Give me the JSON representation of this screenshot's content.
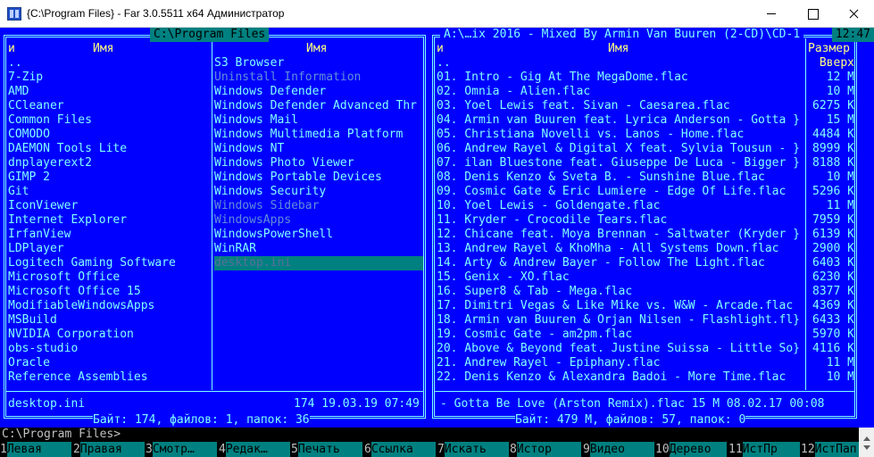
{
  "window": {
    "title": "{C:\\Program Files} - Far 3.0.5511 x64 Администратор"
  },
  "left_panel": {
    "title": "C:\\Program Files",
    "col_n": "и",
    "col_name1": "Имя",
    "col_name2": "Имя",
    "column1": [
      "..",
      "7-Zip",
      "AMD",
      "CCleaner",
      "Common Files",
      "COMODO",
      "DAEMON Tools Lite",
      "dnplayerext2",
      "GIMP 2",
      "Git",
      "IconViewer",
      "Internet Explorer",
      "IrfanView",
      "LDPlayer",
      "Logitech Gaming Software",
      "Microsoft Office",
      "Microsoft Office 15",
      "ModifiableWindowsApps",
      "MSBuild",
      "NVIDIA Corporation",
      "obs-studio",
      "Oracle",
      "Reference Assemblies"
    ],
    "column2": [
      {
        "name": "S3 Browser",
        "state": "normal"
      },
      {
        "name": "Uninstall Information",
        "state": "dim"
      },
      {
        "name": "Windows Defender",
        "state": "normal"
      },
      {
        "name": "Windows Defender Advanced Thr",
        "state": "normal"
      },
      {
        "name": "Windows Mail",
        "state": "normal"
      },
      {
        "name": "Windows Multimedia Platform",
        "state": "normal"
      },
      {
        "name": "Windows NT",
        "state": "normal"
      },
      {
        "name": "Windows Photo Viewer",
        "state": "normal"
      },
      {
        "name": "Windows Portable Devices",
        "state": "normal"
      },
      {
        "name": "Windows Security",
        "state": "normal"
      },
      {
        "name": "Windows Sidebar",
        "state": "dim"
      },
      {
        "name": "WindowsApps",
        "state": "dim"
      },
      {
        "name": "WindowsPowerShell",
        "state": "normal"
      },
      {
        "name": "WinRAR",
        "state": "normal"
      },
      {
        "name": "desktop.ini",
        "state": "selected"
      }
    ],
    "info_name": "desktop.ini",
    "info_meta": "174 19.03.19 07:49",
    "summary": " Байт: 174, файлов: 1, папок: 36 "
  },
  "right_panel": {
    "title": "A:\\…ix 2016 - Mixed By Armin Van Buuren (2-CD)\\CD-1",
    "clock": "12:47",
    "col_n": "и",
    "col_name": "Имя",
    "col_size": "Размер",
    "col_sort": "Вверх",
    "files": [
      {
        "name": "..",
        "size": ""
      },
      {
        "name": "01. Intro - Gig At The MegaDome.flac",
        "size": "12 M"
      },
      {
        "name": "02. Omnia - Alien.flac",
        "size": "10 M"
      },
      {
        "name": "03. Yoel Lewis feat. Sivan - Caesarea.flac",
        "size": "6275 K"
      },
      {
        "name": "04. Armin van Buuren feat. Lyrica Anderson - Gotta }",
        "size": "15 M"
      },
      {
        "name": "05. Christiana Novelli vs. Lanos - Home.flac",
        "size": "4484 K"
      },
      {
        "name": "06. Andrew Rayel & Digital X feat. Sylvia Tousun - }",
        "size": "8999 K"
      },
      {
        "name": "07. ilan Bluestone feat. Giuseppe De Luca - Bigger }",
        "size": "8188 K"
      },
      {
        "name": "08. Denis Kenzo & Sveta B. - Sunshine Blue.flac",
        "size": "10 M"
      },
      {
        "name": "09. Cosmic Gate & Eric Lumiere - Edge Of Life.flac",
        "size": "5296 K"
      },
      {
        "name": "10. Yoel Lewis - Goldengate.flac",
        "size": "11 M"
      },
      {
        "name": "11. Kryder - Crocodile Tears.flac",
        "size": "7959 K"
      },
      {
        "name": "12. Chicane feat. Moya Brennan - Saltwater (Kryder }",
        "size": "6139 K"
      },
      {
        "name": "13. Andrew Rayel & KhoMha - All Systems Down.flac",
        "size": "2900 K"
      },
      {
        "name": "14. Arty & Andrew Bayer - Follow The Light.flac",
        "size": "6403 K"
      },
      {
        "name": "15. Genix - XO.flac",
        "size": "6230 K"
      },
      {
        "name": "16. Super8 & Tab - Mega.flac",
        "size": "8377 K"
      },
      {
        "name": "17. Dimitri Vegas & Like Mike vs. W&W - Arcade.flac",
        "size": "4369 K"
      },
      {
        "name": "18. Armin van Buuren & Orjan Nilsen - Flashlight.fl}",
        "size": "6433 K"
      },
      {
        "name": "19. Cosmic Gate - am2pm.flac",
        "size": "5970 K"
      },
      {
        "name": "20. Above & Beyond feat. Justine Suissa - Little So}",
        "size": "4116 K"
      },
      {
        "name": "21. Andrew Rayel - Epiphany.flac",
        "size": "11 M"
      },
      {
        "name": "22. Denis Kenzo & Alexandra Badoi - More Time.flac",
        "size": "10 M"
      }
    ],
    "info": " - Gotta Be Love (Arston Remix).flac   15 M 08.02.17 00:08",
    "summary": " Байт: 479 М, файлов: 57, папок: 0 "
  },
  "cmdline": "C:\\Program Files>",
  "keybar": [
    {
      "num": "1",
      "label": "Левая"
    },
    {
      "num": "2",
      "label": "Правая"
    },
    {
      "num": "3",
      "label": "Смотр…"
    },
    {
      "num": "4",
      "label": "Редак…"
    },
    {
      "num": "5",
      "label": "Печать"
    },
    {
      "num": "6",
      "label": "Ссылка"
    },
    {
      "num": "7",
      "label": "Искать"
    },
    {
      "num": "8",
      "label": "Истор"
    },
    {
      "num": "9",
      "label": "Видео"
    },
    {
      "num": "10",
      "label": "Дерево"
    },
    {
      "num": "11",
      "label": "ИстПр"
    },
    {
      "num": "12",
      "label": "ИстПап"
    }
  ]
}
